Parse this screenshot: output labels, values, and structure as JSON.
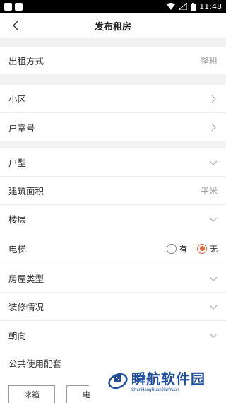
{
  "status": {
    "time": "11:48"
  },
  "header": {
    "title": "发布租房"
  },
  "rental_mode": {
    "label": "出租方式",
    "value": "整租"
  },
  "community": {
    "label": "小区"
  },
  "unit_no": {
    "label": "户室号"
  },
  "layout": {
    "label": "户型"
  },
  "area": {
    "label": "建筑面积",
    "placeholder": "平米"
  },
  "floor": {
    "label": "楼层"
  },
  "elevator": {
    "label": "电梯",
    "options": [
      "有",
      "无"
    ],
    "selected": "无"
  },
  "house_type": {
    "label": "房屋类型"
  },
  "decoration": {
    "label": "装修情况"
  },
  "orientation": {
    "label": "朝向"
  },
  "amenities": {
    "label": "公共使用配套",
    "chips": [
      "冰箱",
      "电"
    ]
  },
  "watermark": {
    "title": "瞬航软件园",
    "subtitle": "ShunHangRuanJianYuan"
  },
  "colors": {
    "accent": "#e8643c",
    "watermark": "#1f4e9e"
  }
}
